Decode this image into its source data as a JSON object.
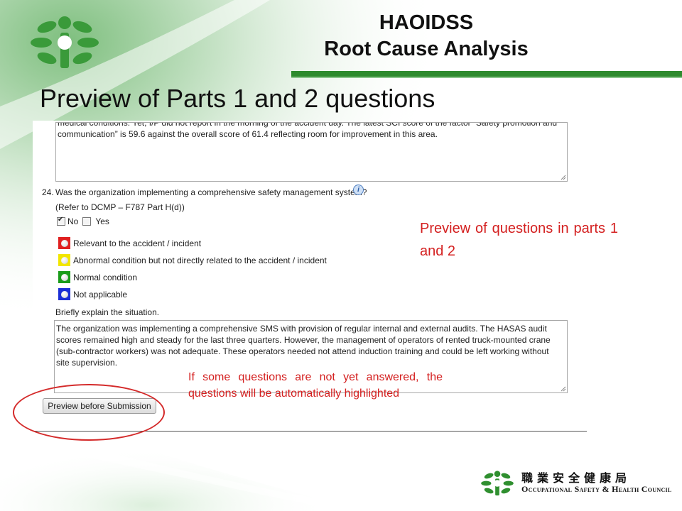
{
  "header": {
    "title_line1": "HAOIDSS",
    "title_line2": "Root Cause Analysis",
    "accent_color": "#2e8b2e"
  },
  "slide_title": "Preview of Parts 1 and 2 questions",
  "form": {
    "previous_answer_lines": [
      "medical conditions. Yet, I/P did not report in the morning of the accident day. The latest SCI score of the factor “Safety promotion and",
      "communication” is 59.6 against the overall score of 61.4 reflecting room for improvement in this area."
    ],
    "question": {
      "number": "24.",
      "text": "Was the organization implementing a comprehensive safety management system?",
      "reference": "(Refer to DCMP – F787 Part H(d))",
      "info_icon": "info-icon"
    },
    "options": {
      "no_label": "No",
      "yes_label": "Yes",
      "no_checked": true,
      "yes_checked": false
    },
    "legend": [
      {
        "label": "Relevant to the accident / incident",
        "color": "#e02020",
        "icon": "status-red-icon"
      },
      {
        "label": "Abnormal condition but not directly related to the accident / incident",
        "color": "#f2e600",
        "icon": "status-yellow-icon"
      },
      {
        "label": "Normal condition",
        "color": "#1a9c1a",
        "icon": "status-green-icon"
      },
      {
        "label": "Not applicable",
        "color": "#1c2fd6",
        "icon": "status-blue-icon"
      }
    ],
    "explain_label": "Briefly explain the situation.",
    "explanation_lines": [
      "The organization was implementing a comprehensive SMS with provision of regular internal and external audits. The HASAS audit",
      "scores remained high and steady for the last three quarters. However, the management of operators of rented truck-mounted crane",
      "(sub-contractor workers) was not adequate. These operators needed not attend induction training and could be left working without",
      "site supervision."
    ],
    "preview_button_label": "Preview before Submission"
  },
  "annotations": {
    "right_note": "Preview of questions in parts 1 and 2",
    "bottom_note": "If some questions are not yet answered, the questions will be automatically highlighted",
    "highlight_color": "#d42020"
  },
  "branding": {
    "chinese_name": "職業安全健康局",
    "english_name": "Occupational Safety & Health Council"
  }
}
